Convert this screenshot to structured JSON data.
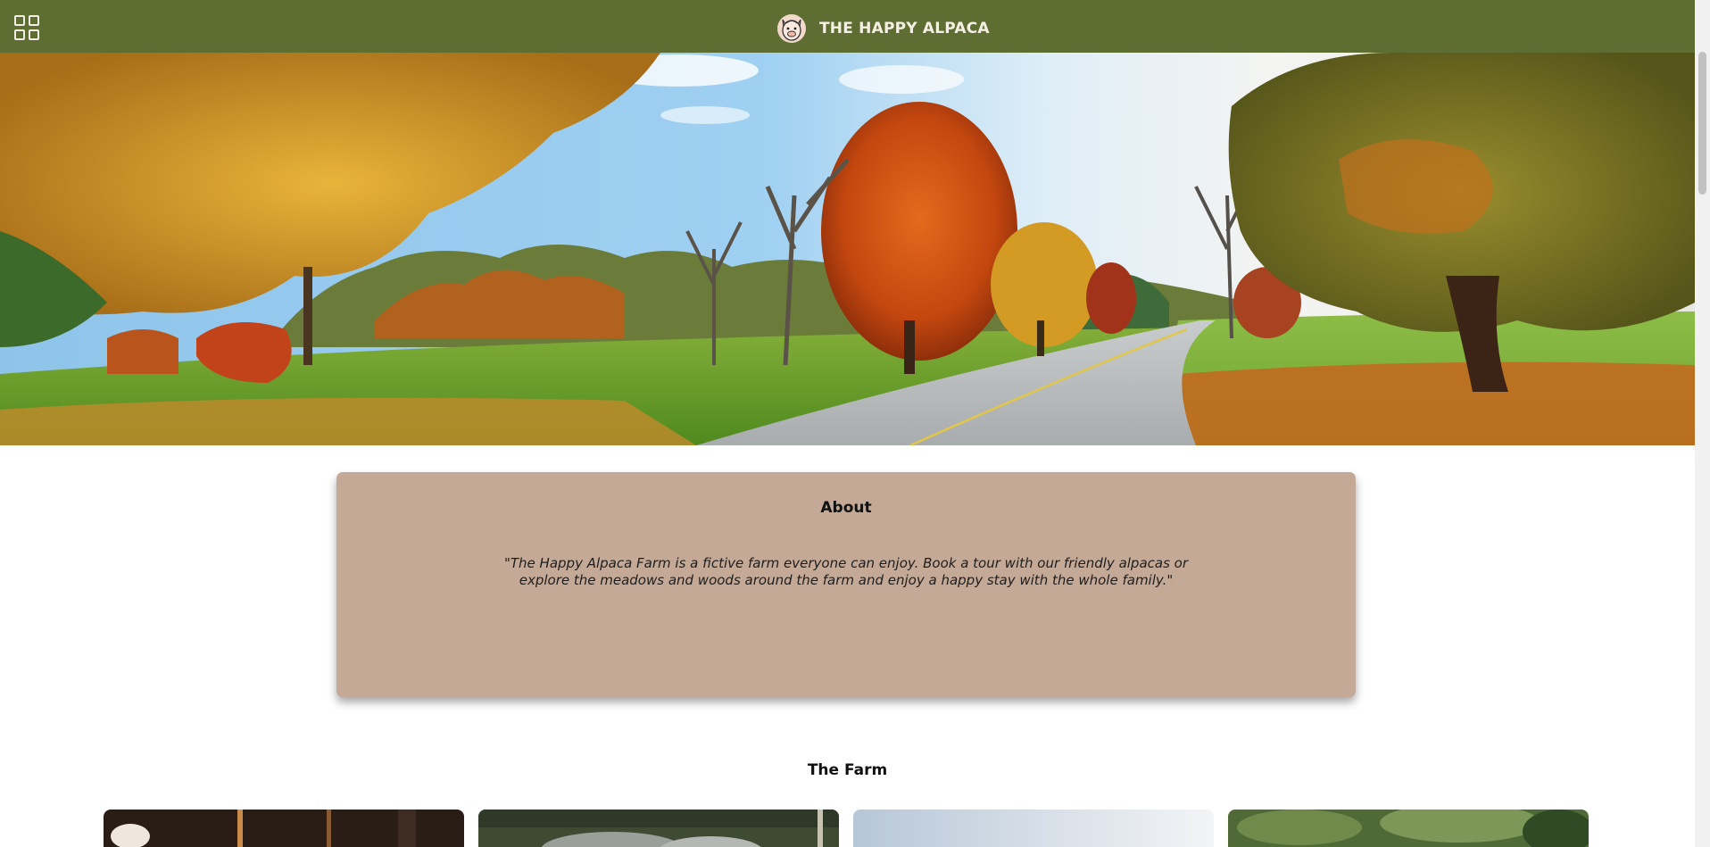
{
  "header": {
    "title": "THE HAPPY ALPACA",
    "menu_icon": "grid-menu-icon",
    "logo_icon": "alpaca-logo-icon",
    "background": "#5e6e33"
  },
  "hero": {
    "image_description_icon": "autumn-road-landscape"
  },
  "about": {
    "title": "About",
    "text": "\"The Happy Alpaca Farm is a fictive farm everyone can enjoy. Book a tour with our friendly alpacas or explore the meadows and woods around the farm and enjoy a happy stay with the whole family.\"",
    "background": "#c4a997"
  },
  "farm": {
    "title": "The Farm",
    "cards": [
      {
        "icon": "barn-interior-photo"
      },
      {
        "icon": "stone-wall-photo"
      },
      {
        "icon": "sky-meadow-photo"
      },
      {
        "icon": "forest-photo"
      }
    ]
  }
}
